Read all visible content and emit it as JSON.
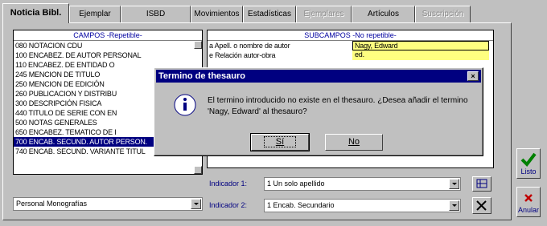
{
  "tabs": [
    {
      "label": "Noticia Bibl.",
      "state": "active"
    },
    {
      "label": "Ejemplar",
      "state": "normal"
    },
    {
      "label": "ISBD",
      "state": "normal"
    },
    {
      "label": "Movimientos",
      "state": "normal"
    },
    {
      "label": "Estadísticas",
      "state": "normal"
    },
    {
      "label": "Ejemplares",
      "state": "disabled"
    },
    {
      "label": "Artículos",
      "state": "normal"
    },
    {
      "label": "Suscripción",
      "state": "disabled"
    }
  ],
  "campos": {
    "header": "CAMPOS -Repetible-",
    "items": [
      "080 NOTACION CDU",
      "100 ENCABEZ. DE AUTOR PERSONAL",
      "110 ENCABEZ. DE ENTIDAD O",
      "245 MENCION DE TITULO",
      "250 MENCION DE EDICIÓN",
      "260 PUBLICACION Y DISTRIBU",
      "300 DESCRIPCIÓN FISICA",
      "440 TITULO DE SERIE CON EN",
      "500 NOTAS GENERALES",
      "650 ENCABEZ. TEMATICO DE I",
      "700 ENCAB. SECUND. AUTOR PERSON.",
      "740 ENCAB. SECUND. VARIANTE TITUL"
    ],
    "selected_index": 10
  },
  "subcampos": {
    "header": "SUBCAMPOS -No repetible-",
    "rows": [
      {
        "label": "a Apell. o nombre de autor",
        "value": "Nagy, Edward"
      },
      {
        "label": "e Relación autor-obra",
        "value": "ed."
      }
    ]
  },
  "template_combo": {
    "value": "Personal Monografías"
  },
  "indicadores": [
    {
      "label": "Indicador 1:",
      "value": "1 Un solo apellido"
    },
    {
      "label": "Indicador 2:",
      "value": "1 Encab. Secundario"
    }
  ],
  "side_buttons": {
    "listo": "Listo",
    "anular": "Anular"
  },
  "dialog": {
    "title": "Termino de thesauro",
    "message": "El termino introducido no existe en el thesauro. ¿Desea añadir el termino 'Nagy, Edward' al thesauro?",
    "yes": "Sí",
    "no": "No",
    "close": "×"
  },
  "colors": {
    "titlebar": "#000080",
    "selection": "#000080",
    "highlight": "#ffff80",
    "accent_green": "#008000",
    "accent_red": "#c00000"
  }
}
